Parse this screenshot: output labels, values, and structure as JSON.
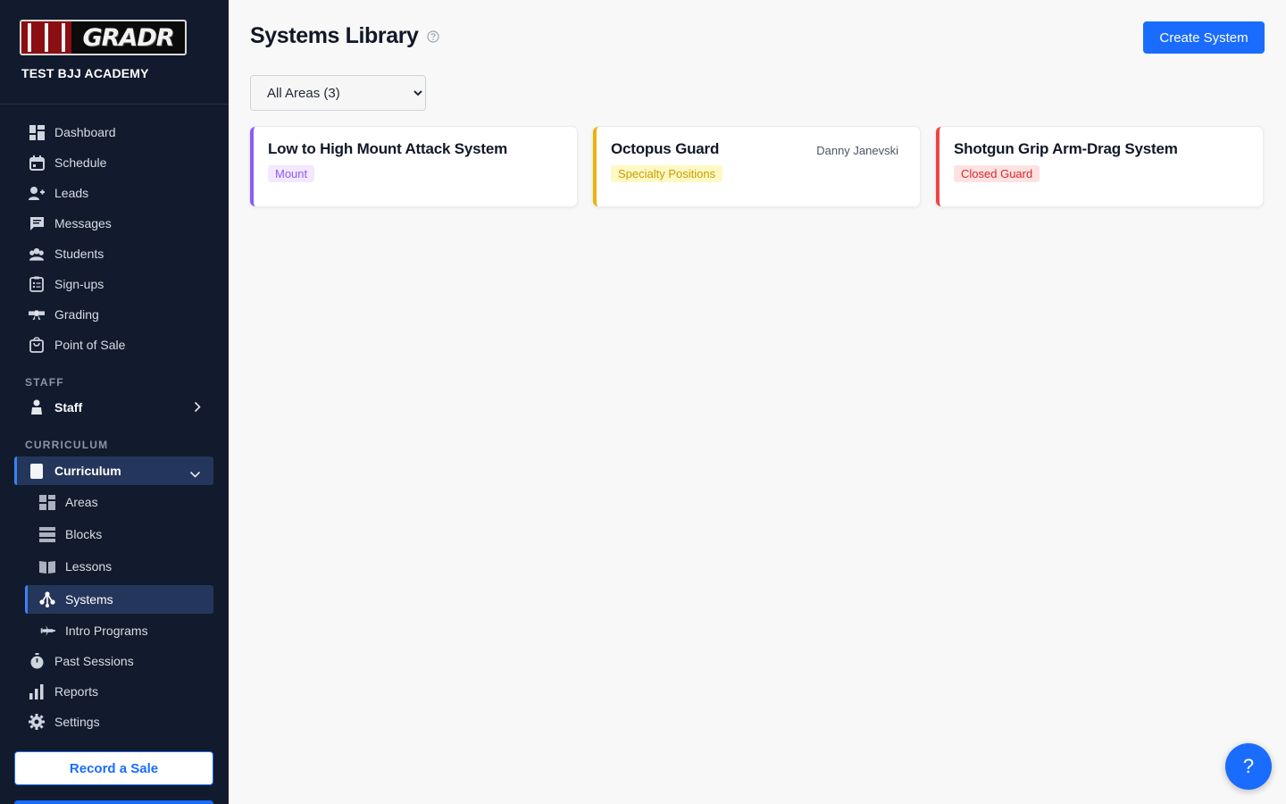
{
  "sidebar": {
    "logo_text": "GRADR",
    "academy": "TEST BJJ ACADEMY",
    "main_items": [
      {
        "label": "Dashboard",
        "icon": "dashboard-icon"
      },
      {
        "label": "Schedule",
        "icon": "calendar-icon"
      },
      {
        "label": "Leads",
        "icon": "add-user-icon"
      },
      {
        "label": "Messages",
        "icon": "chat-icon"
      },
      {
        "label": "Students",
        "icon": "group-icon"
      },
      {
        "label": "Sign-ups",
        "icon": "clipboard-icon"
      },
      {
        "label": "Grading",
        "icon": "belt-icon"
      },
      {
        "label": "Point of Sale",
        "icon": "shopping-bag-icon"
      }
    ],
    "staff_section": "STAFF",
    "staff_item": "Staff",
    "curriculum_section": "CURRICULUM",
    "curriculum_item": "Curriculum",
    "curriculum_sub": [
      {
        "label": "Areas",
        "icon": "grid-icon"
      },
      {
        "label": "Blocks",
        "icon": "stack-icon"
      },
      {
        "label": "Lessons",
        "icon": "book-icon"
      },
      {
        "label": "Systems",
        "icon": "network-icon"
      },
      {
        "label": "Intro Programs",
        "icon": "airplane-icon"
      }
    ],
    "after_items": [
      {
        "label": "Past Sessions",
        "icon": "stopwatch-icon"
      },
      {
        "label": "Reports",
        "icon": "bar-chart-icon"
      },
      {
        "label": "Settings",
        "icon": "gear-icon"
      }
    ],
    "record_sale": "Record a Sale"
  },
  "header": {
    "title": "Systems Library",
    "create_button": "Create System"
  },
  "filter": {
    "selected": "All Areas (3)"
  },
  "cards": [
    {
      "title": "Low to High Mount Attack System",
      "tag": "Mount",
      "author": "",
      "accent": "#8b5cf6",
      "tag_bg": "#f3e8ff",
      "tag_fg": "#8b5cf6"
    },
    {
      "title": "Octopus Guard",
      "tag": "Specialty Positions",
      "author": "Danny Janevski",
      "accent": "#eab308",
      "tag_bg": "#fef9c3",
      "tag_fg": "#ca9a04"
    },
    {
      "title": "Shotgun Grip Arm-Drag System",
      "tag": "Closed Guard",
      "author": "",
      "accent": "#ef4444",
      "tag_bg": "#fee2e2",
      "tag_fg": "#dc2626"
    }
  ],
  "help_button": "?"
}
